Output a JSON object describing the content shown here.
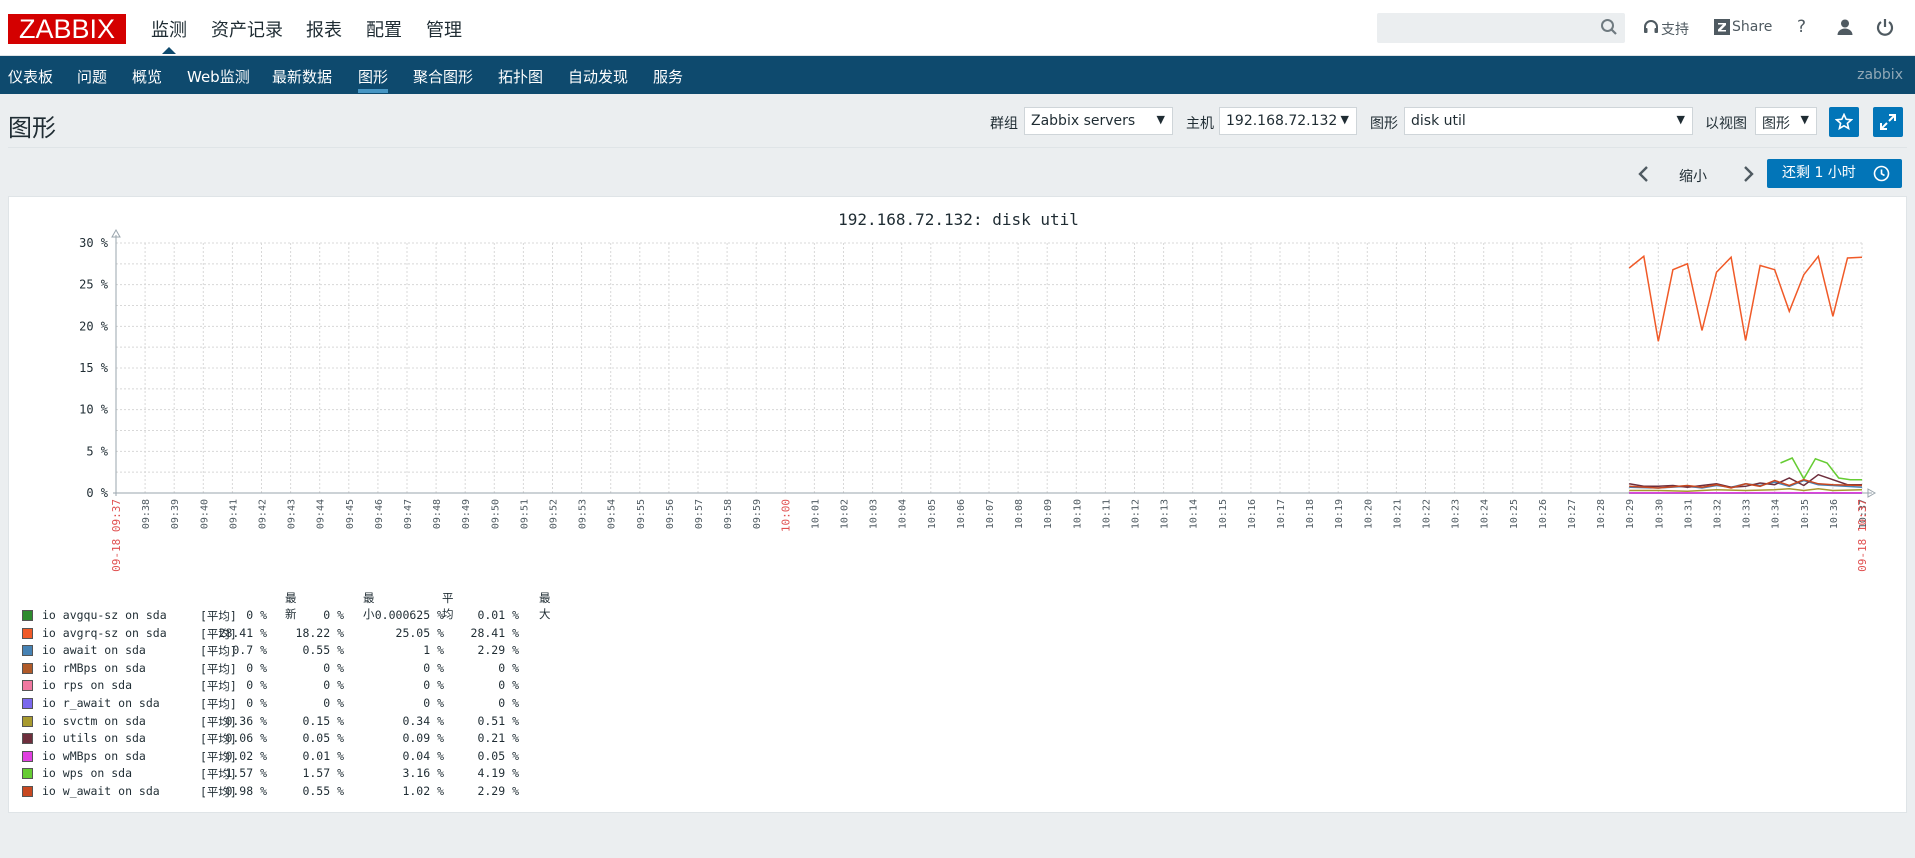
{
  "app": {
    "logo": "ZABBIX"
  },
  "top_menu": [
    {
      "label": "监测",
      "active": true
    },
    {
      "label": "资产记录",
      "active": false
    },
    {
      "label": "报表",
      "active": false
    },
    {
      "label": "配置",
      "active": false
    },
    {
      "label": "管理",
      "active": false
    }
  ],
  "top_right": {
    "search_value": "",
    "support_label": "支持",
    "share_label": "Share",
    "help": "?"
  },
  "nav": {
    "items": [
      {
        "label": "仪表板",
        "active": false
      },
      {
        "label": "问题",
        "active": false
      },
      {
        "label": "概览",
        "active": false
      },
      {
        "label": "Web监测",
        "active": false
      },
      {
        "label": "最新数据",
        "active": false
      },
      {
        "label": "图形",
        "active": true
      },
      {
        "label": "聚合图形",
        "active": false
      },
      {
        "label": "拓扑图",
        "active": false
      },
      {
        "label": "自动发现",
        "active": false
      },
      {
        "label": "服务",
        "active": false
      }
    ],
    "user": "zabbix"
  },
  "header": {
    "title": "图形",
    "filters": {
      "group_label": "群组",
      "group_value": "Zabbix servers",
      "host_label": "主机",
      "host_value": "192.168.72.132",
      "graph_label": "图形",
      "graph_value": "disk util",
      "view_label": "以视图",
      "view_value": "图形"
    }
  },
  "time_controls": {
    "zoom_out_label": "缩小",
    "period_label": "还剩 1 小时"
  },
  "colors": {
    "brand": "#d40000",
    "nav_bg": "#0e4a6e",
    "accent": "#0275b8",
    "red_text": "#e05050"
  },
  "chart_data": {
    "type": "line",
    "title": "192.168.72.132: disk util",
    "y_ticks": [
      "30 %",
      "25 %",
      "20 %",
      "15 %",
      "10 %",
      "5 %",
      "0 %"
    ],
    "ylim": [
      0,
      30
    ],
    "x_ticks": [
      "09:38",
      "09:39",
      "09:40",
      "09:41",
      "09:42",
      "09:43",
      "09:44",
      "09:45",
      "09:46",
      "09:47",
      "09:48",
      "09:49",
      "09:50",
      "09:51",
      "09:52",
      "09:53",
      "09:54",
      "09:55",
      "09:56",
      "09:57",
      "09:58",
      "09:59",
      "10:00",
      "10:01",
      "10:02",
      "10:03",
      "10:04",
      "10:05",
      "10:06",
      "10:07",
      "10:08",
      "10:09",
      "10:10",
      "10:11",
      "10:12",
      "10:13",
      "10:14",
      "10:15",
      "10:16",
      "10:17",
      "10:18",
      "10:19",
      "10:20",
      "10:21",
      "10:22",
      "10:23",
      "10:24",
      "10:25",
      "10:26",
      "10:27",
      "10:28",
      "10:29",
      "10:30",
      "10:31",
      "10:32",
      "10:33",
      "10:34",
      "10:35",
      "10:36",
      "10:37"
    ],
    "x_start_label": "09-18 09:37",
    "x_end_label": "09-18 10:37",
    "xlim_minutes": [
      0,
      60
    ],
    "grid": true,
    "series": [
      {
        "name": "io avgqu-sz on sda",
        "color": "#2e8b2e",
        "x": [
          52,
          60
        ],
        "y": [
          0,
          0
        ]
      },
      {
        "name": "io avgrq-sz on sda",
        "color": "#f05a28",
        "x": [
          52,
          52.5,
          53,
          53.5,
          54,
          54.5,
          55,
          55.5,
          56,
          56.5,
          57,
          57.5,
          58,
          58.5,
          59,
          59.5,
          60
        ],
        "y": [
          27,
          28.4,
          18.2,
          26.8,
          27.5,
          19.5,
          26.5,
          28.3,
          18.3,
          27.3,
          26.8,
          21.8,
          26.2,
          28.4,
          21.2,
          28.2,
          28.3
        ]
      },
      {
        "name": "io await on sda",
        "color": "#4682b4",
        "x": [
          52,
          53,
          54,
          54.5,
          55,
          55.5,
          56,
          56.5,
          57,
          57.5,
          58,
          58.5,
          59,
          60
        ],
        "y": [
          0.7,
          0.6,
          0.8,
          0.6,
          0.9,
          0.7,
          1.1,
          0.9,
          1.3,
          0.8,
          1.5,
          1.0,
          0.9,
          0.7
        ]
      },
      {
        "name": "io rMBps on sda",
        "color": "#b05a28",
        "x": [
          52,
          60
        ],
        "y": [
          0,
          0
        ]
      },
      {
        "name": "io rps on sda",
        "color": "#f078a0",
        "x": [
          52,
          60
        ],
        "y": [
          0,
          0
        ]
      },
      {
        "name": "io r_await on sda",
        "color": "#7b68ee",
        "x": [
          52,
          60
        ],
        "y": [
          0,
          0
        ]
      },
      {
        "name": "io svctm on sda",
        "color": "#a89a2e",
        "x": [
          52,
          53,
          54,
          55,
          56,
          57,
          57.5,
          58,
          58.5,
          59,
          60
        ],
        "y": [
          0.3,
          0.3,
          0.2,
          0.4,
          0.3,
          0.4,
          0.5,
          0.3,
          0.5,
          0.3,
          0.4
        ]
      },
      {
        "name": "io utils on sda",
        "color": "#6e2e3c",
        "x": [
          52,
          52.5,
          53,
          53.5,
          54,
          54.5,
          55,
          55.5,
          56,
          56.5,
          57,
          57.5,
          58,
          58.5,
          59,
          59.5,
          60
        ],
        "y": [
          1.1,
          0.8,
          0.8,
          0.9,
          0.7,
          0.9,
          1.1,
          0.7,
          0.8,
          1.2,
          1.0,
          1.8,
          0.9,
          2.2,
          1.6,
          1.0,
          1.0
        ]
      },
      {
        "name": "io wMBps on sda",
        "color": "#e040e0",
        "x": [
          52,
          53,
          54,
          55,
          56,
          57,
          58,
          59,
          60
        ],
        "y": [
          0.02,
          0.03,
          0.02,
          0.04,
          0.03,
          0.05,
          0.04,
          0.03,
          0.02
        ]
      },
      {
        "name": "io wps on sda",
        "color": "#66cc33",
        "x": [
          57.2,
          57.6,
          58,
          58.4,
          58.8,
          59.2,
          59.6,
          60
        ],
        "y": [
          3.6,
          4.2,
          1.7,
          4.1,
          3.6,
          1.8,
          1.6,
          1.6
        ]
      },
      {
        "name": "io w_await on sda",
        "color": "#c84820",
        "x": [
          52,
          53,
          54,
          54.5,
          55,
          55.5,
          56,
          56.5,
          57,
          57.5,
          58,
          58.5,
          59,
          60
        ],
        "y": [
          0.8,
          0.6,
          0.9,
          0.7,
          1.0,
          0.6,
          1.1,
          0.8,
          1.5,
          0.9,
          1.6,
          1.1,
          1.0,
          0.9
        ]
      }
    ]
  },
  "legend": {
    "headers": {
      "last": "最新",
      "min": "最小",
      "avg": "平均",
      "max": "最大"
    },
    "rows": [
      {
        "name": "io avgqu-sz on sda",
        "color": "#2e8b2e",
        "fn": "[平均]",
        "last": "0 %",
        "min": "0 %",
        "avg": "0.000625 %",
        "max": "0.01 %"
      },
      {
        "name": "io avgrq-sz on sda",
        "color": "#f05a28",
        "fn": "[平均]",
        "last": "28.41 %",
        "min": "18.22 %",
        "avg": "25.05 %",
        "max": "28.41 %"
      },
      {
        "name": "io await on sda",
        "color": "#4682b4",
        "fn": "[平均]",
        "last": "0.7 %",
        "min": "0.55 %",
        "avg": "1 %",
        "max": "2.29 %"
      },
      {
        "name": "io rMBps on sda",
        "color": "#b05a28",
        "fn": "[平均]",
        "last": "0 %",
        "min": "0 %",
        "avg": "0 %",
        "max": "0 %"
      },
      {
        "name": "io rps on sda",
        "color": "#f078a0",
        "fn": "[平均]",
        "last": "0 %",
        "min": "0 %",
        "avg": "0 %",
        "max": "0 %"
      },
      {
        "name": "io r_await on sda",
        "color": "#7b68ee",
        "fn": "[平均]",
        "last": "0 %",
        "min": "0 %",
        "avg": "0 %",
        "max": "0 %"
      },
      {
        "name": "io svctm on sda",
        "color": "#a89a2e",
        "fn": "[平均]",
        "last": "0.36 %",
        "min": "0.15 %",
        "avg": "0.34 %",
        "max": "0.51 %"
      },
      {
        "name": "io utils on sda",
        "color": "#6e2e3c",
        "fn": "[平均]",
        "last": "0.06 %",
        "min": "0.05 %",
        "avg": "0.09 %",
        "max": "0.21 %"
      },
      {
        "name": "io wMBps on sda",
        "color": "#e040e0",
        "fn": "[平均]",
        "last": "0.02 %",
        "min": "0.01 %",
        "avg": "0.04 %",
        "max": "0.05 %"
      },
      {
        "name": "io wps on sda",
        "color": "#66cc33",
        "fn": "[平均]",
        "last": "1.57 %",
        "min": "1.57 %",
        "avg": "3.16 %",
        "max": "4.19 %"
      },
      {
        "name": "io w_await on sda",
        "color": "#c84820",
        "fn": "[平均]",
        "last": "0.98 %",
        "min": "0.55 %",
        "avg": "1.02 %",
        "max": "2.29 %"
      }
    ]
  }
}
